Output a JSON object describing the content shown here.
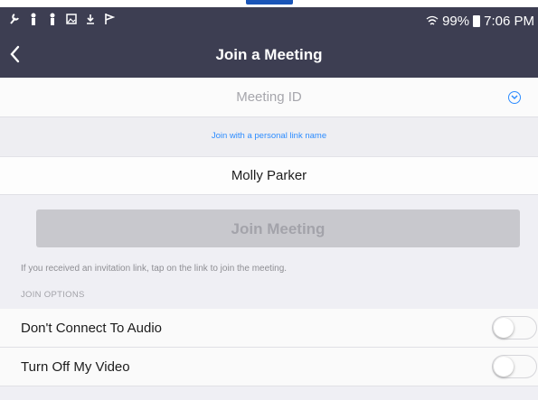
{
  "status_bar": {
    "left_icons": [
      "wrench-icon",
      "person-icon",
      "person-icon",
      "image-icon",
      "download-icon",
      "flag-icon"
    ],
    "battery": "99%",
    "time": "7:06 PM"
  },
  "nav": {
    "title": "Join a Meeting",
    "back_glyph": "<"
  },
  "meeting_id": {
    "placeholder": "Meeting ID"
  },
  "personal_link": {
    "label": "Join with a personal link name"
  },
  "name_field": {
    "value": "Molly Parker"
  },
  "join_button": {
    "label": "Join Meeting"
  },
  "hint": "If you received an invitation link, tap on the link to join the meeting.",
  "join_options": {
    "header": "JOIN OPTIONS",
    "items": [
      {
        "label": "Don't Connect To Audio",
        "on": false
      },
      {
        "label": "Turn Off My Video",
        "on": false
      }
    ]
  },
  "colors": {
    "header_bg": "#3d3e52",
    "accent": "#2d8cff",
    "page_bg": "#efeff4"
  }
}
